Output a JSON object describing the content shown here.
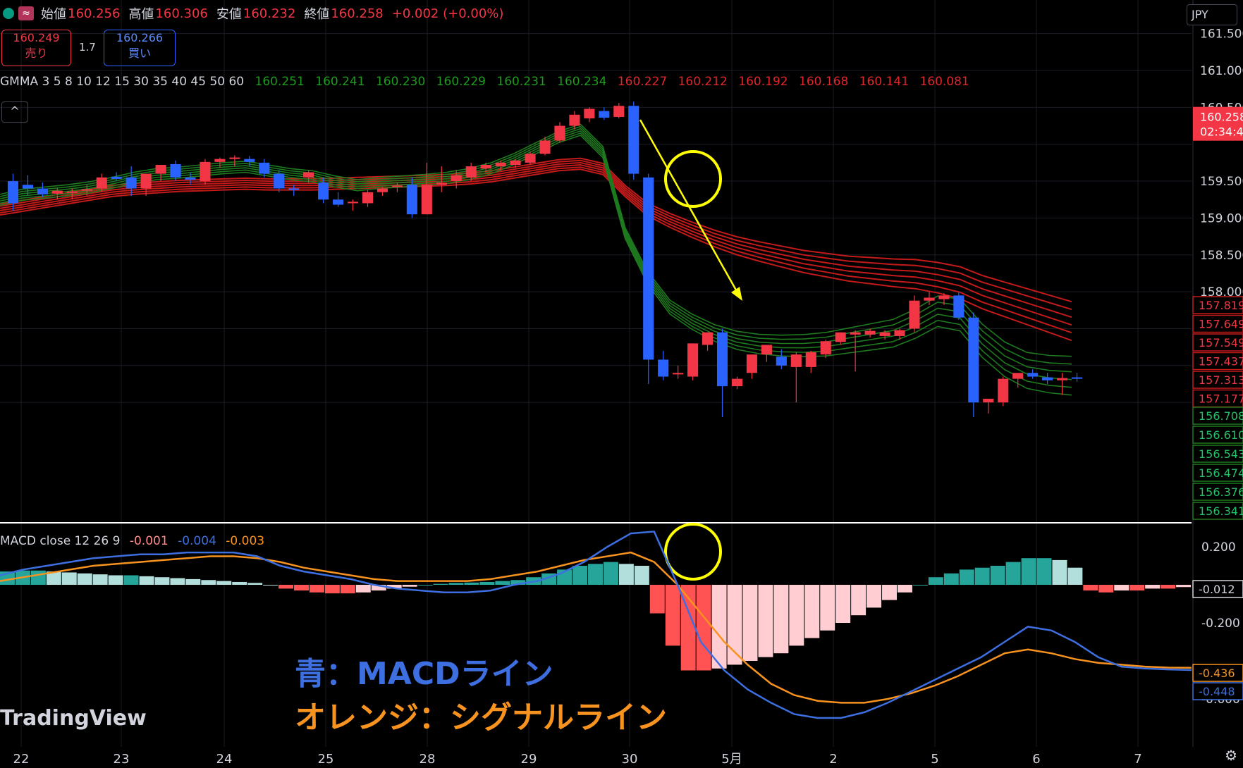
{
  "ohlc": {
    "open_label": "始値",
    "open": "160.256",
    "high_label": "高値",
    "high": "160.306",
    "low_label": "安値",
    "low": "160.232",
    "close_label": "終値",
    "close": "160.258",
    "change": "+0.002 (+0.00%)",
    "wave_icon": "≈"
  },
  "trade": {
    "sell_price": "160.249",
    "sell_label": "売り",
    "spread": "1.7",
    "buy_price": "160.266",
    "buy_label": "買い"
  },
  "currency": "JPY",
  "gmma": {
    "name": "GMMA 3 5 8 10 12 15 30 35 40 45 50 60",
    "short_values": [
      "160.251",
      "160.241",
      "160.230",
      "160.229",
      "160.231",
      "160.234"
    ],
    "long_values": [
      "160.227",
      "160.212",
      "160.192",
      "160.168",
      "160.141",
      "160.081"
    ]
  },
  "collapse_label": "^",
  "macd": {
    "name": "MACD close 12 26 9",
    "hist": "-0.001",
    "macd": "-0.004",
    "signal": "-0.003"
  },
  "annotations": {
    "blue": "青：MACDライン",
    "orange": "オレンジ：シグナルライン"
  },
  "logo": "TradingView",
  "gear_icon": "⚙",
  "colors": {
    "up": "#f23645",
    "down": "#2962ff",
    "gmma_short": "#1e7a1e",
    "gmma_long": "#c41a1a",
    "macd": "#3d6fe0",
    "signal": "#f7931e",
    "hist_pos_strong": "#26a69a",
    "hist_pos_weak": "#b2dfdb",
    "hist_neg_strong": "#ff5252",
    "hist_neg_weak": "#ffcdd2",
    "highlight": "#ffff00"
  },
  "chart_data": [
    {
      "type": "candlestick",
      "title": "",
      "x_ticks": [
        "22",
        "23",
        "24",
        "25",
        "28",
        "29",
        "30",
        "5月",
        "2",
        "5",
        "6",
        "7"
      ],
      "y_ticks": [
        "161.500",
        "161.000",
        "160.500",
        "159.500",
        "159.000",
        "158.500",
        "158.000"
      ],
      "ylim": [
        156.25,
        161.6
      ],
      "current_price": "160.258",
      "countdown": "02:34:4",
      "price_tags_red": [
        "157.819",
        "157.649",
        "157.549",
        "157.437",
        "157.313",
        "157.177"
      ],
      "price_tags_green": [
        "156.708",
        "156.610",
        "156.543",
        "156.474",
        "156.376",
        "156.341"
      ],
      "candles": [
        {
          "o": 159.5,
          "h": 159.6,
          "l": 159.1,
          "c": 159.2
        },
        {
          "o": 159.45,
          "h": 159.58,
          "l": 159.3,
          "c": 159.4
        },
        {
          "o": 159.4,
          "h": 159.48,
          "l": 159.28,
          "c": 159.32
        },
        {
          "o": 159.33,
          "h": 159.4,
          "l": 159.25,
          "c": 159.37
        },
        {
          "o": 159.35,
          "h": 159.4,
          "l": 159.25,
          "c": 159.36
        },
        {
          "o": 159.37,
          "h": 159.45,
          "l": 159.3,
          "c": 159.39
        },
        {
          "o": 159.4,
          "h": 159.6,
          "l": 159.35,
          "c": 159.55
        },
        {
          "o": 159.56,
          "h": 159.62,
          "l": 159.5,
          "c": 159.53
        },
        {
          "o": 159.55,
          "h": 159.7,
          "l": 159.3,
          "c": 159.4
        },
        {
          "o": 159.4,
          "h": 159.6,
          "l": 159.3,
          "c": 159.6
        },
        {
          "o": 159.6,
          "h": 159.7,
          "l": 159.5,
          "c": 159.72
        },
        {
          "o": 159.73,
          "h": 159.78,
          "l": 159.5,
          "c": 159.55
        },
        {
          "o": 159.55,
          "h": 159.62,
          "l": 159.45,
          "c": 159.52
        },
        {
          "o": 159.5,
          "h": 159.8,
          "l": 159.45,
          "c": 159.76
        },
        {
          "o": 159.76,
          "h": 159.82,
          "l": 159.68,
          "c": 159.8
        },
        {
          "o": 159.8,
          "h": 159.85,
          "l": 159.7,
          "c": 159.82
        },
        {
          "o": 159.8,
          "h": 159.84,
          "l": 159.7,
          "c": 159.76
        },
        {
          "o": 159.75,
          "h": 159.8,
          "l": 159.55,
          "c": 159.6
        },
        {
          "o": 159.6,
          "h": 159.65,
          "l": 159.35,
          "c": 159.4
        },
        {
          "o": 159.4,
          "h": 159.45,
          "l": 159.3,
          "c": 159.38
        },
        {
          "o": 159.55,
          "h": 159.65,
          "l": 159.48,
          "c": 159.62
        },
        {
          "o": 159.48,
          "h": 159.55,
          "l": 159.2,
          "c": 159.25
        },
        {
          "o": 159.25,
          "h": 159.35,
          "l": 159.15,
          "c": 159.18
        },
        {
          "o": 159.2,
          "h": 159.25,
          "l": 159.1,
          "c": 159.22
        },
        {
          "o": 159.2,
          "h": 159.38,
          "l": 159.15,
          "c": 159.35
        },
        {
          "o": 159.35,
          "h": 159.42,
          "l": 159.3,
          "c": 159.4
        },
        {
          "o": 159.42,
          "h": 159.48,
          "l": 159.35,
          "c": 159.44
        },
        {
          "o": 159.45,
          "h": 159.55,
          "l": 159.0,
          "c": 159.05
        },
        {
          "o": 159.05,
          "h": 159.75,
          "l": 159.05,
          "c": 159.45
        },
        {
          "o": 159.45,
          "h": 159.7,
          "l": 159.35,
          "c": 159.48
        },
        {
          "o": 159.5,
          "h": 159.65,
          "l": 159.4,
          "c": 159.58
        },
        {
          "o": 159.55,
          "h": 159.75,
          "l": 159.5,
          "c": 159.7
        },
        {
          "o": 159.67,
          "h": 159.75,
          "l": 159.62,
          "c": 159.72
        },
        {
          "o": 159.7,
          "h": 159.78,
          "l": 159.65,
          "c": 159.75
        },
        {
          "o": 159.72,
          "h": 159.8,
          "l": 159.68,
          "c": 159.78
        },
        {
          "o": 159.75,
          "h": 159.9,
          "l": 159.72,
          "c": 159.87
        },
        {
          "o": 159.87,
          "h": 160.1,
          "l": 159.85,
          "c": 160.05
        },
        {
          "o": 160.05,
          "h": 160.3,
          "l": 160.02,
          "c": 160.25
        },
        {
          "o": 160.25,
          "h": 160.45,
          "l": 160.2,
          "c": 160.4
        },
        {
          "o": 160.35,
          "h": 160.5,
          "l": 160.3,
          "c": 160.48
        },
        {
          "o": 160.45,
          "h": 160.5,
          "l": 160.33,
          "c": 160.36
        },
        {
          "o": 160.37,
          "h": 160.56,
          "l": 160.35,
          "c": 160.52
        },
        {
          "o": 160.52,
          "h": 160.58,
          "l": 159.52,
          "c": 159.6
        },
        {
          "o": 159.55,
          "h": 159.6,
          "l": 156.75,
          "c": 157.08
        },
        {
          "o": 157.08,
          "h": 157.2,
          "l": 156.8,
          "c": 156.85
        },
        {
          "o": 156.88,
          "h": 157.0,
          "l": 156.82,
          "c": 156.9
        },
        {
          "o": 156.85,
          "h": 157.3,
          "l": 156.8,
          "c": 157.3
        },
        {
          "o": 157.28,
          "h": 157.45,
          "l": 157.2,
          "c": 157.45
        },
        {
          "o": 157.45,
          "h": 157.5,
          "l": 156.3,
          "c": 156.72
        },
        {
          "o": 156.72,
          "h": 156.85,
          "l": 156.68,
          "c": 156.82
        },
        {
          "o": 156.9,
          "h": 157.15,
          "l": 156.82,
          "c": 157.15
        },
        {
          "o": 157.15,
          "h": 157.28,
          "l": 157.05,
          "c": 157.28
        },
        {
          "o": 157.12,
          "h": 157.22,
          "l": 156.95,
          "c": 157.0
        },
        {
          "o": 156.98,
          "h": 157.18,
          "l": 156.5,
          "c": 157.15
        },
        {
          "o": 156.98,
          "h": 157.2,
          "l": 156.9,
          "c": 157.18
        },
        {
          "o": 157.15,
          "h": 157.35,
          "l": 157.1,
          "c": 157.33
        },
        {
          "o": 157.32,
          "h": 157.45,
          "l": 157.28,
          "c": 157.45
        },
        {
          "o": 157.42,
          "h": 157.48,
          "l": 156.92,
          "c": 157.45
        },
        {
          "o": 157.42,
          "h": 157.5,
          "l": 157.38,
          "c": 157.47
        },
        {
          "o": 157.4,
          "h": 157.48,
          "l": 157.35,
          "c": 157.45
        },
        {
          "o": 157.4,
          "h": 157.5,
          "l": 157.35,
          "c": 157.48
        },
        {
          "o": 157.5,
          "h": 157.95,
          "l": 157.45,
          "c": 157.88
        },
        {
          "o": 157.88,
          "h": 158.0,
          "l": 157.82,
          "c": 157.92
        },
        {
          "o": 157.9,
          "h": 157.98,
          "l": 157.82,
          "c": 157.95
        },
        {
          "o": 157.95,
          "h": 158.0,
          "l": 157.62,
          "c": 157.65
        },
        {
          "o": 157.65,
          "h": 157.72,
          "l": 156.3,
          "c": 156.5
        },
        {
          "o": 156.5,
          "h": 156.55,
          "l": 156.35,
          "c": 156.55
        },
        {
          "o": 156.5,
          "h": 156.85,
          "l": 156.45,
          "c": 156.82
        },
        {
          "o": 156.82,
          "h": 156.9,
          "l": 156.7,
          "c": 156.9
        },
        {
          "o": 156.9,
          "h": 156.95,
          "l": 156.82,
          "c": 156.85
        },
        {
          "o": 156.84,
          "h": 156.9,
          "l": 156.75,
          "c": 156.8
        },
        {
          "o": 156.8,
          "h": 156.9,
          "l": 156.6,
          "c": 156.83
        },
        {
          "o": 156.84,
          "h": 156.9,
          "l": 156.78,
          "c": 156.82
        }
      ],
      "gmma_short_center": [
        159.25,
        159.32,
        159.35,
        159.38,
        159.42,
        159.48,
        159.55,
        159.6,
        159.62,
        159.65,
        159.68,
        159.7,
        159.65,
        159.6,
        159.57,
        159.5,
        159.45,
        159.48,
        159.5,
        159.52,
        159.55,
        159.6,
        159.68,
        159.8,
        159.95,
        160.1,
        160.2,
        159.9,
        158.8,
        158.2,
        157.8,
        157.6,
        157.45,
        157.35,
        157.3,
        157.28,
        157.28,
        157.3,
        157.35,
        157.4,
        157.45,
        157.58,
        157.75,
        157.7,
        157.35,
        157.1,
        156.95,
        156.9,
        156.88
      ],
      "gmma_long_center": [
        159.1,
        159.15,
        159.2,
        159.25,
        159.3,
        159.35,
        159.38,
        159.4,
        159.42,
        159.43,
        159.44,
        159.45,
        159.44,
        159.44,
        159.44,
        159.45,
        159.46,
        159.47,
        159.48,
        159.49,
        159.5,
        159.52,
        159.55,
        159.6,
        159.65,
        159.7,
        159.72,
        159.65,
        159.35,
        159.1,
        158.95,
        158.82,
        158.7,
        158.6,
        158.52,
        158.45,
        158.38,
        158.33,
        158.28,
        158.25,
        158.22,
        158.2,
        158.15,
        158.08,
        157.95,
        157.85,
        157.75,
        157.65,
        157.55
      ],
      "arrow": {
        "from": [
          908,
          170
        ],
        "to": [
          1053,
          427
        ]
      }
    },
    {
      "type": "macd",
      "y_ticks": [
        "0.200",
        "-0.200",
        "-0.600"
      ],
      "ylim": [
        -0.75,
        0.33
      ],
      "macd_value_tag": "-0.448",
      "signal_value_tag": "-0.436",
      "hist_value_tag": "-0.012",
      "histogram": [
        0.07,
        0.075,
        0.075,
        0.07,
        0.065,
        0.06,
        0.055,
        0.05,
        0.05,
        0.045,
        0.04,
        0.035,
        0.03,
        0.025,
        0.02,
        0.015,
        0.01,
        0.0,
        -0.02,
        -0.03,
        -0.04,
        -0.045,
        -0.045,
        -0.04,
        -0.03,
        -0.02,
        -0.01,
        -0.0,
        0.005,
        0.01,
        0.012,
        0.015,
        0.02,
        0.025,
        0.04,
        0.06,
        0.08,
        0.1,
        0.11,
        0.12,
        0.11,
        0.1,
        -0.15,
        -0.32,
        -0.45,
        -0.45,
        -0.44,
        -0.42,
        -0.4,
        -0.38,
        -0.36,
        -0.32,
        -0.28,
        -0.24,
        -0.2,
        -0.16,
        -0.12,
        -0.08,
        -0.04,
        0.0,
        0.04,
        0.06,
        0.08,
        0.09,
        0.1,
        0.12,
        0.14,
        0.14,
        0.13,
        0.09,
        -0.03,
        -0.04,
        -0.03,
        -0.03,
        -0.02,
        -0.02,
        -0.012
      ],
      "macd_line": [
        0.05,
        0.08,
        0.1,
        0.12,
        0.14,
        0.15,
        0.16,
        0.16,
        0.17,
        0.17,
        0.17,
        0.15,
        0.1,
        0.07,
        0.05,
        0.03,
        0.0,
        -0.02,
        -0.03,
        -0.04,
        -0.04,
        -0.03,
        0.0,
        0.02,
        0.06,
        0.12,
        0.2,
        0.27,
        0.28,
        0.0,
        -0.3,
        -0.45,
        -0.55,
        -0.62,
        -0.68,
        -0.7,
        -0.7,
        -0.67,
        -0.62,
        -0.56,
        -0.5,
        -0.44,
        -0.38,
        -0.3,
        -0.22,
        -0.24,
        -0.3,
        -0.38,
        -0.43,
        -0.44,
        -0.445,
        -0.448
      ],
      "signal_line": [
        0.02,
        0.04,
        0.06,
        0.08,
        0.1,
        0.11,
        0.12,
        0.13,
        0.14,
        0.15,
        0.15,
        0.14,
        0.12,
        0.09,
        0.07,
        0.05,
        0.03,
        0.02,
        0.02,
        0.02,
        0.02,
        0.03,
        0.05,
        0.07,
        0.1,
        0.13,
        0.15,
        0.17,
        0.12,
        0.0,
        -0.15,
        -0.3,
        -0.42,
        -0.52,
        -0.58,
        -0.61,
        -0.62,
        -0.62,
        -0.6,
        -0.57,
        -0.53,
        -0.48,
        -0.42,
        -0.36,
        -0.34,
        -0.36,
        -0.39,
        -0.41,
        -0.42,
        -0.43,
        -0.435,
        -0.436
      ]
    }
  ]
}
